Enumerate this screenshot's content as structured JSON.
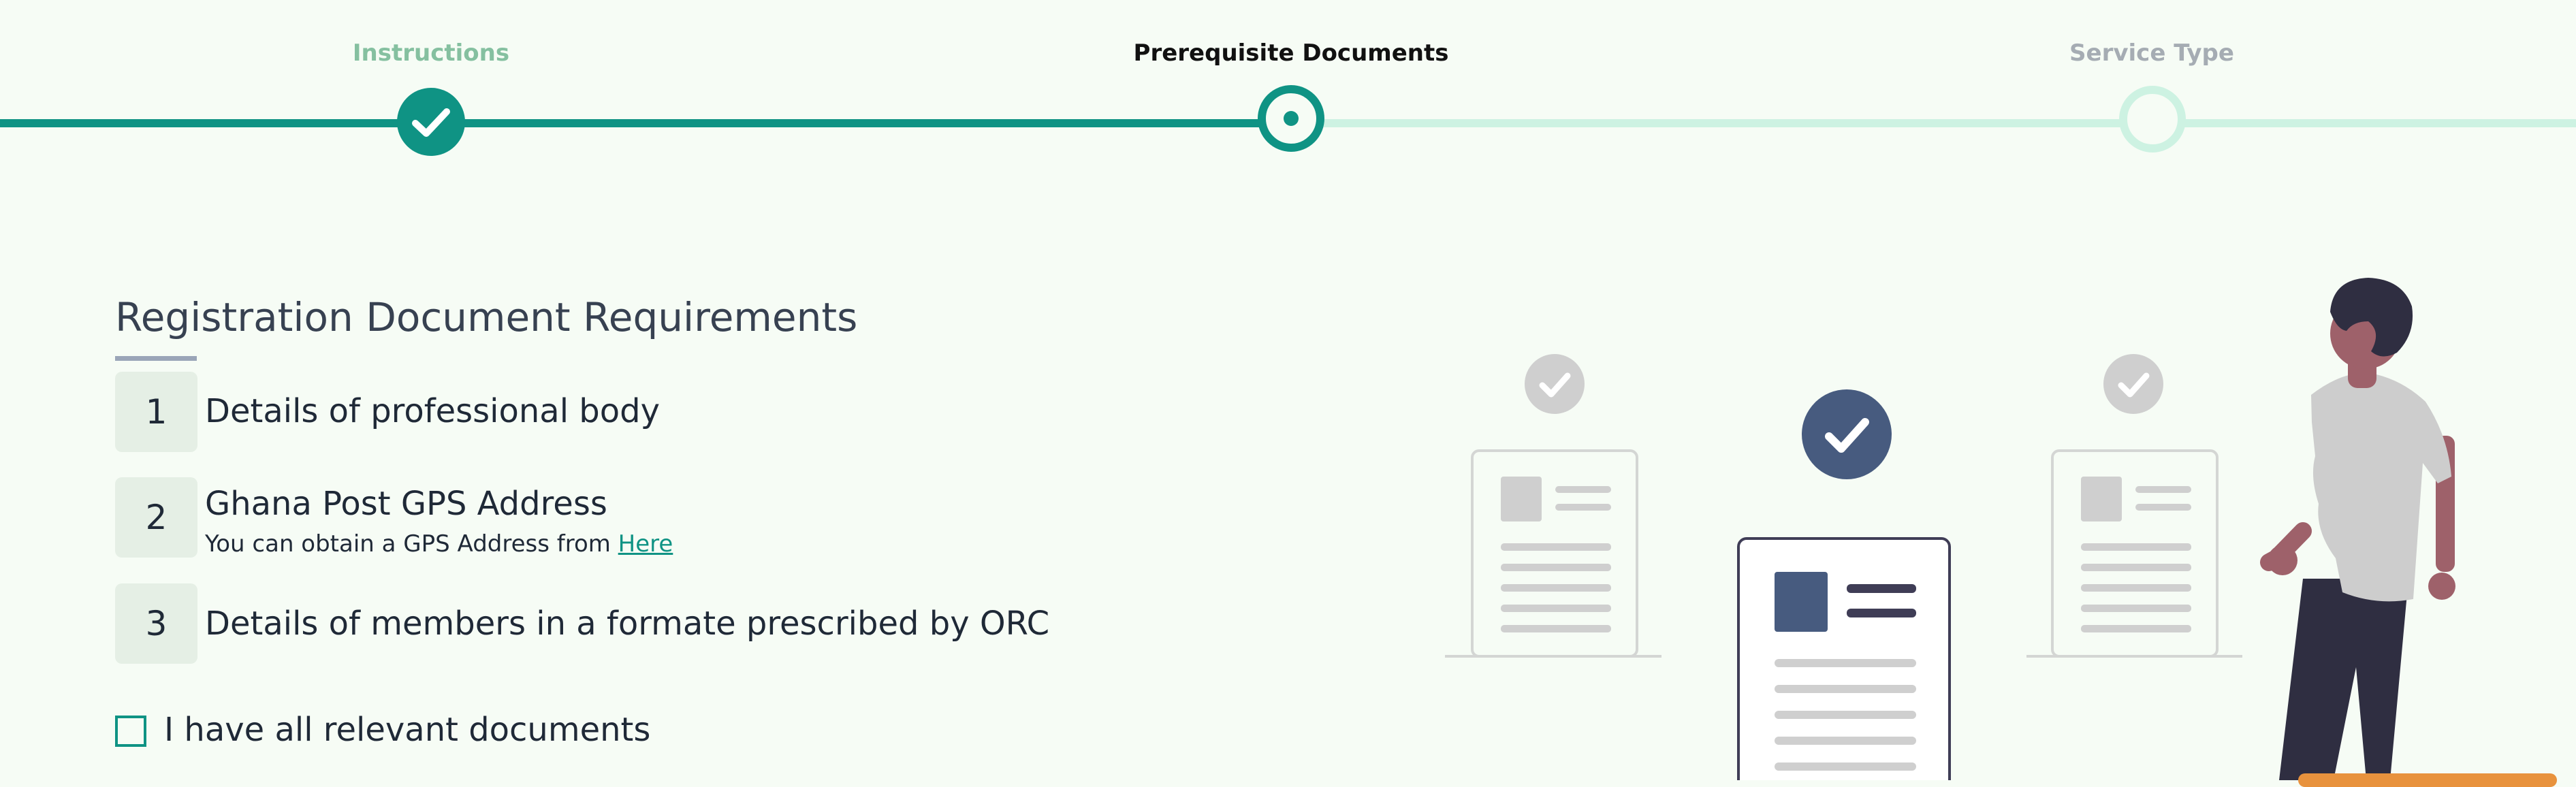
{
  "stepper": {
    "steps": [
      {
        "label": "Instructions",
        "state": "completed"
      },
      {
        "label": "Prerequisite Documents",
        "state": "current"
      },
      {
        "label": "Service Type",
        "state": "upcoming"
      }
    ],
    "colors": {
      "active": "#0f9384",
      "inactive": "#cdf2e2"
    }
  },
  "main": {
    "title": "Registration Document Requirements",
    "requirements": [
      {
        "number": "1",
        "title": "Details of professional body"
      },
      {
        "number": "2",
        "title": "Ghana Post GPS Address",
        "subtext": "You can obtain a GPS Address from ",
        "link_text": "Here"
      },
      {
        "number": "3",
        "title": "Details of members in a formate prescribed by ORC"
      }
    ],
    "confirm_checkbox": {
      "label": "I have all relevant documents",
      "checked": false
    }
  },
  "colors": {
    "background": "#f6fcf5",
    "accent": "#0f9384",
    "illustration_primary": "#475b7f",
    "button": "#e8923d"
  }
}
